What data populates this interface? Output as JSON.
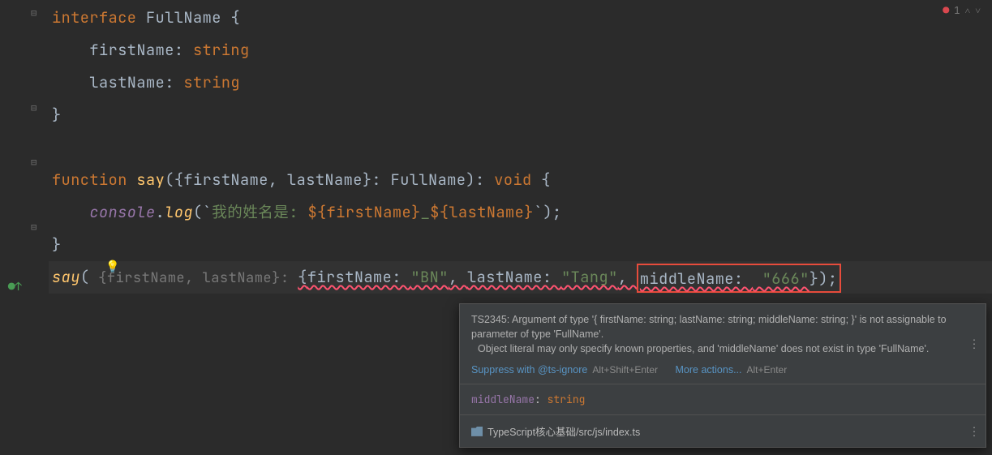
{
  "problems": {
    "error_count": "1"
  },
  "code": {
    "l1": {
      "kw": "interface",
      "name": "FullName",
      "open": "{"
    },
    "l2": {
      "prop": "firstName",
      "colon": ": ",
      "type": "string"
    },
    "l3": {
      "prop": "lastName",
      "colon": ": ",
      "type": "string"
    },
    "l4": {
      "close": "}"
    },
    "l6": {
      "kw": "function",
      "name": "say",
      "params": "({firstName, lastName}: FullName): ",
      "ret": "void",
      "open": " {"
    },
    "l7": {
      "obj": "console",
      "dot": ".",
      "method": "log",
      "open": "(`",
      "tmpl1": "我的姓名是: ",
      "expr1": "${firstName}",
      "sep": "_",
      "expr2": "${lastName}",
      "close": "`);"
    },
    "l8": {
      "close": "}"
    },
    "l10": {
      "fn": "say",
      "open": "(",
      "hint": " {firstName, lastName}: ",
      "obj_open": "{",
      "p1": "firstName: ",
      "v1": "\"BN\"",
      "c1": ", ",
      "p2": "lastName: ",
      "v2": "\"Tang\"",
      "c2": ", ",
      "p3": "middleName: ",
      "v3": "\"666\"",
      "obj_close": "}",
      "close": ");"
    }
  },
  "tooltip": {
    "msg1": "TS2345: Argument of type '{ firstName: string; lastName: string; middleName: string; }' is not assignable to parameter of type 'FullName'.",
    "msg2": "Object literal may only specify known properties, and 'middleName' does not exist in type 'FullName'.",
    "suppress_label": "Suppress with @ts-ignore",
    "suppress_shortcut": "Alt+Shift+Enter",
    "more_label": "More actions...",
    "more_shortcut": "Alt+Enter",
    "sig_prop": "middleName",
    "sig_colon": ": ",
    "sig_type": "string",
    "path": "TypeScript核心基础/src/js/index.ts"
  }
}
